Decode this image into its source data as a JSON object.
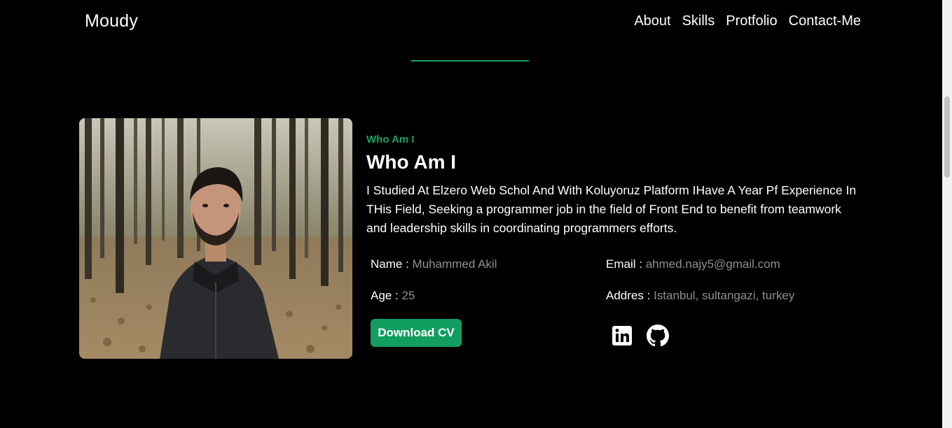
{
  "navbar": {
    "brand": "Moudy",
    "links": [
      "About",
      "Skills",
      "Protfolio",
      "Contact-Me"
    ]
  },
  "about": {
    "eyebrow": "Who Am I",
    "title": "Who Am I",
    "bio": "I Studied At Elzero Web Schol And With Koluyoruz Platform IHave A Year Pf Experience In THis Field, Seeking a programmer job in the field of Front End to benefit from teamwork and leadership skills in coordinating programmers efforts.",
    "name_label": "Name :",
    "name_value": "Muhammed Akil",
    "age_label": "Age :",
    "age_value": "25",
    "email_label": "Email :",
    "email_value": "ahmed.najy5@gmail.com",
    "address_label": "Addres :",
    "address_value": "Istanbul, sultangazi, turkey",
    "download_label": "Download CV"
  },
  "social": [
    "linkedin-icon",
    "github-icon"
  ],
  "colors": {
    "accent": "#16a363",
    "background": "#000000",
    "muted": "#8f8f8f"
  }
}
